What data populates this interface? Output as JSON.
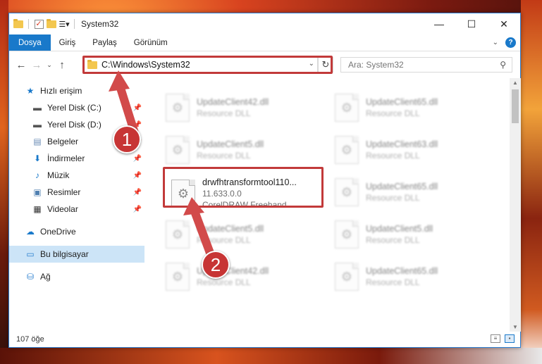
{
  "window": {
    "title": "System32",
    "controls": {
      "minimize": "—",
      "maximize": "☐",
      "close": "✕"
    }
  },
  "ribbon": {
    "tabs": [
      "Dosya",
      "Giriş",
      "Paylaş",
      "Görünüm"
    ]
  },
  "navigation": {
    "address": "C:\\Windows\\System32",
    "search_placeholder": "Ara: System32"
  },
  "sidebar": {
    "items": [
      {
        "label": "Hızlı erişim",
        "icon": "star-icon",
        "pinned": false
      },
      {
        "label": "Yerel Disk (C:)",
        "icon": "drive-icon",
        "pinned": true
      },
      {
        "label": "Yerel Disk (D:)",
        "icon": "drive-icon",
        "pinned": true
      },
      {
        "label": "Belgeler",
        "icon": "documents-icon",
        "pinned": true
      },
      {
        "label": "İndirmeler",
        "icon": "download-icon",
        "pinned": true
      },
      {
        "label": "Müzik",
        "icon": "music-icon",
        "pinned": true
      },
      {
        "label": "Resimler",
        "icon": "pictures-icon",
        "pinned": true
      },
      {
        "label": "Videolar",
        "icon": "videos-icon",
        "pinned": true
      },
      {
        "label": "OneDrive",
        "icon": "cloud-icon",
        "pinned": false
      },
      {
        "label": "Bu bilgisayar",
        "icon": "computer-icon",
        "pinned": false,
        "selected": true
      },
      {
        "label": "Ağ",
        "icon": "network-icon",
        "pinned": false
      }
    ]
  },
  "files": [
    {
      "name": "UpdateClient42.dll",
      "type": "Resource DLL"
    },
    {
      "name": "UpdateClient65.dll",
      "type": "Resource DLL"
    },
    {
      "name": "UpdateClient5.dll",
      "type": "Resource DLL"
    },
    {
      "name": "UpdateClient63.dll",
      "type": "Resource DLL"
    },
    {
      "name": "drwfhtransformtool110...",
      "version": "11.633.0.0",
      "type": "CorelDRAW Freehand ...",
      "highlighted": true
    },
    {
      "name": "UpdateClient65.dll",
      "type": "Resource DLL"
    },
    {
      "name": "UpdateClient5.dll",
      "type": "Resource DLL"
    },
    {
      "name": "UpdateClient5.dll",
      "type": "Resource DLL"
    },
    {
      "name": "UpdateClient42.dll",
      "type": "Resource DLL"
    },
    {
      "name": "UpdateClient65.dll",
      "type": "Resource DLL"
    }
  ],
  "status": {
    "item_count": "107 öğe"
  },
  "annotations": {
    "step1": "1",
    "step2": "2"
  },
  "colors": {
    "accent": "#1979ca",
    "highlight_box": "#c23a3a",
    "badge": "#c73535",
    "selection": "#cce4f7"
  }
}
